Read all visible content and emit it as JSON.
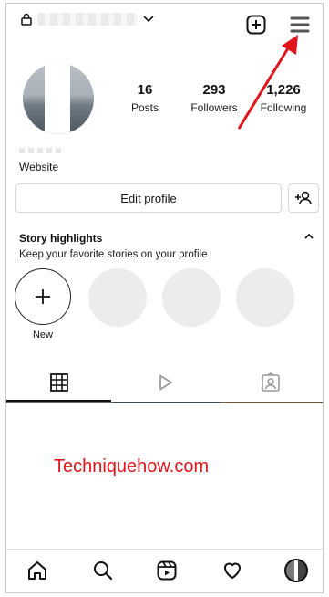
{
  "stats": [
    {
      "value": "16",
      "label": "Posts"
    },
    {
      "value": "293",
      "label": "Followers"
    },
    {
      "value": "1,226",
      "label": "Following"
    }
  ],
  "profile": {
    "website_label": "Website",
    "edit_label": "Edit profile"
  },
  "highlights": {
    "title": "Story highlights",
    "subtitle": "Keep your favorite stories on your profile",
    "new_label": "New"
  },
  "watermark": "Techniquehow.com",
  "colors": {
    "annotation_arrow": "#e0151b",
    "watermark": "#e0151b"
  }
}
